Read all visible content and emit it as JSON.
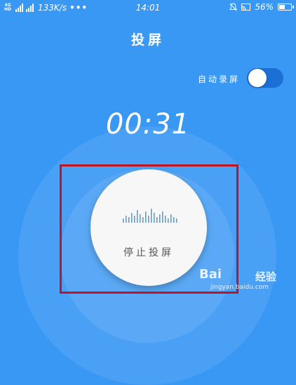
{
  "status_bar": {
    "network_top": "4G",
    "network_bottom": "HD",
    "speed": "133K/s",
    "more": "•••",
    "time": "14:01",
    "battery": "56%",
    "battery_level": 0.56,
    "icons": [
      "signal-icon",
      "signal-icon",
      "bell-off-icon",
      "cast-icon",
      "battery-icon"
    ]
  },
  "title": "投屏",
  "auto_record": {
    "label": "自动录屏",
    "enabled": false
  },
  "timer": "00:31",
  "stop_button": {
    "label": "停止投屏",
    "icon": "sound-wave-icon"
  },
  "watermark": {
    "logo": "Bai  ",
    "text": "经验",
    "url": "jingyan.baidu.com"
  },
  "colors": {
    "background": "#3a98f5",
    "highlight": "#c0141e",
    "toggle": "#1c6fd4",
    "button": "#f7f7f7",
    "wave": "#4a9be0"
  }
}
